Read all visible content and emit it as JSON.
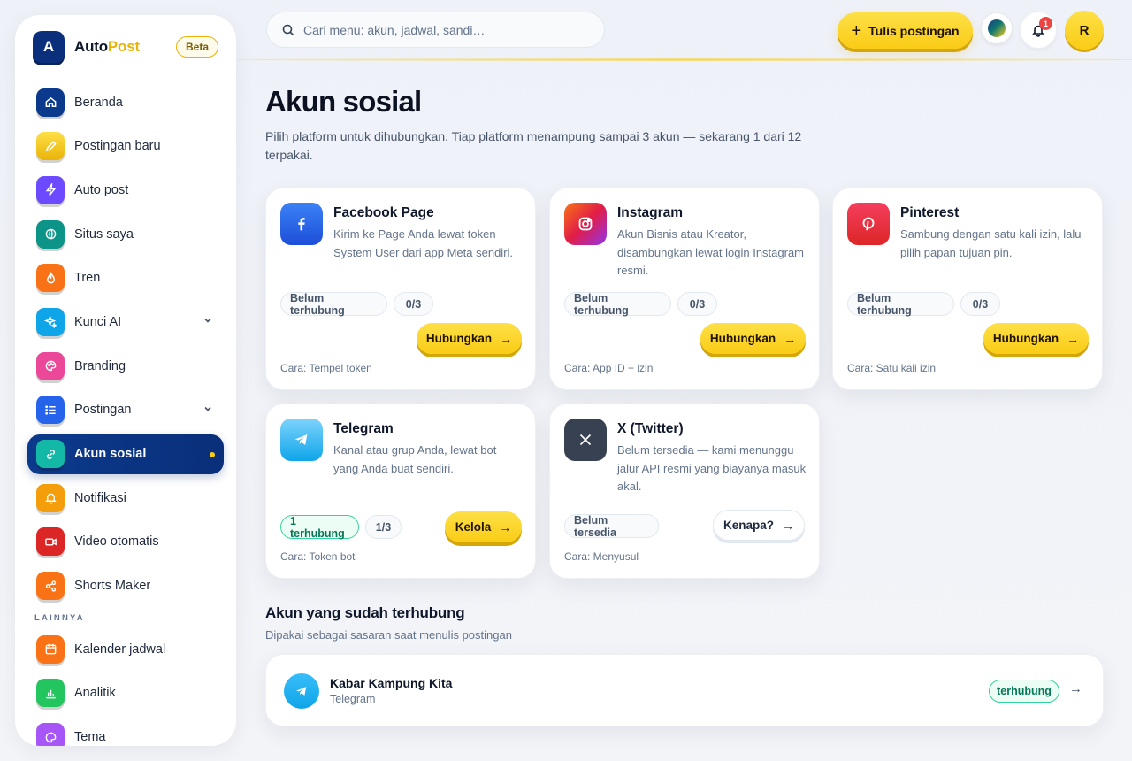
{
  "brand": {
    "logo_letter": "A",
    "name_part1": "Auto",
    "name_part2": "Post",
    "beta": "Beta"
  },
  "sidebar": {
    "items": [
      {
        "label": "Beranda",
        "icon": "home-icon",
        "color": "#0b3a8c"
      },
      {
        "label": "Postingan baru",
        "icon": "pencil-icon",
        "color": "#facc15"
      },
      {
        "label": "Auto post",
        "icon": "bolt-icon",
        "color": "#6d4aff"
      },
      {
        "label": "Situs saya",
        "icon": "globe-icon",
        "color": "#0d9488"
      },
      {
        "label": "Tren",
        "icon": "flame-icon",
        "color": "#f97316"
      },
      {
        "label": "Kunci AI",
        "icon": "sparkle-icon",
        "color": "#0ea5e9"
      },
      {
        "label": "Branding",
        "icon": "palette-icon",
        "color": "#ec4899"
      },
      {
        "label": "Postingan",
        "icon": "list-icon",
        "color": "#2563eb"
      },
      {
        "label": "Akun sosial",
        "icon": "link-icon",
        "color": "#14b8a6"
      },
      {
        "label": "Notifikasi",
        "icon": "bell-icon",
        "color": "#f59e0b"
      },
      {
        "label": "Video otomatis",
        "icon": "video-icon",
        "color": "#dc2626"
      },
      {
        "label": "Shorts Maker",
        "icon": "share-icon",
        "color": "#f97316"
      }
    ],
    "section_label": "LAINNYA",
    "other_items": [
      {
        "label": "Kalender jadwal",
        "icon": "calendar-icon",
        "color": "#f97316"
      },
      {
        "label": "Analitik",
        "icon": "chart-icon",
        "color": "#22c55e"
      },
      {
        "label": "Tema",
        "icon": "palette-icon",
        "color": "#a855f7"
      }
    ]
  },
  "search": {
    "placeholder": "Cari menu: akun, jadwal, sandi…"
  },
  "header": {
    "write_label": "Tulis postingan",
    "notif_count": "1",
    "avatar_letter": "R"
  },
  "main": {
    "title": "Akun sosial",
    "subtitle": "Pilih platform untuk dihubungkan. Tiap platform menampung sampai 3 akun — sekarang 1 dari 12 terpakai."
  },
  "cards": [
    {
      "title": "Facebook Page",
      "desc": "Kirim ke Page Anda lewat token System User dari app Meta sendiri.",
      "status": "Belum terhubung",
      "count": "0/3",
      "button": "Hubungkan",
      "foot": "Cara: Tempel token"
    },
    {
      "title": "Instagram",
      "desc": "Akun Bisnis atau Kreator, disambungkan lewat login Instagram resmi.",
      "status": "Belum terhubung",
      "count": "0/3",
      "button": "Hubungkan",
      "foot": "Cara: App ID + izin"
    },
    {
      "title": "Pinterest",
      "desc": "Sambung dengan satu kali izin, lalu pilih papan tujuan pin.",
      "status": "Belum terhubung",
      "count": "0/3",
      "button": "Hubungkan",
      "foot": "Cara: Satu kali izin"
    },
    {
      "title": "Telegram",
      "desc": "Kanal atau grup Anda, lewat bot yang Anda buat sendiri.",
      "status": "1 terhubung",
      "count": "1/3",
      "button": "Kelola",
      "foot": "Cara: Token bot"
    },
    {
      "title": "X (Twitter)",
      "desc": "Belum tersedia — kami menunggu jalur API resmi yang biayanya masuk akal.",
      "status": "Belum tersedia",
      "button": "Kenapa?",
      "foot": "Cara: Menyusul"
    }
  ],
  "connected": {
    "title": "Akun yang sudah terhubung",
    "subtitle": "Dipakai sebagai sasaran saat menulis postingan",
    "accounts": [
      {
        "name": "Kabar Kampung Kita",
        "platform": "Telegram",
        "status": "terhubung"
      }
    ]
  }
}
